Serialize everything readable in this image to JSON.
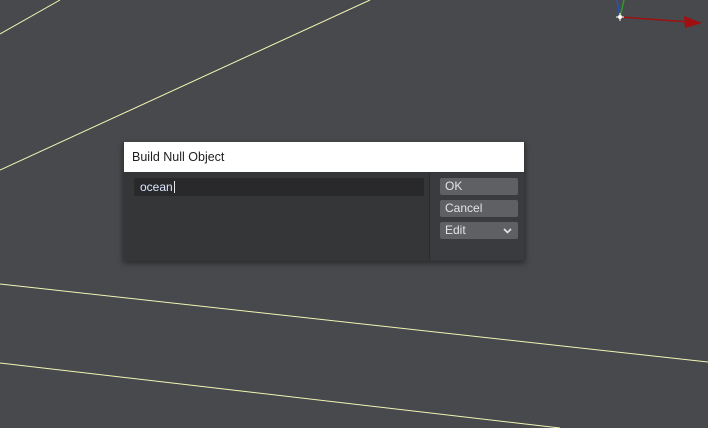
{
  "viewport": {
    "line_color": "#f2f5b6",
    "axis_x_color": "#a01010",
    "axis_y_color": "#2c9a2c",
    "axis_z_color": "#2a4fbf"
  },
  "dialog": {
    "title": "Build Null Object",
    "name_value": "ocean",
    "ok_label": "OK",
    "cancel_label": "Cancel",
    "edit_label": "Edit",
    "edit_icon": "chevron-down-icon"
  }
}
